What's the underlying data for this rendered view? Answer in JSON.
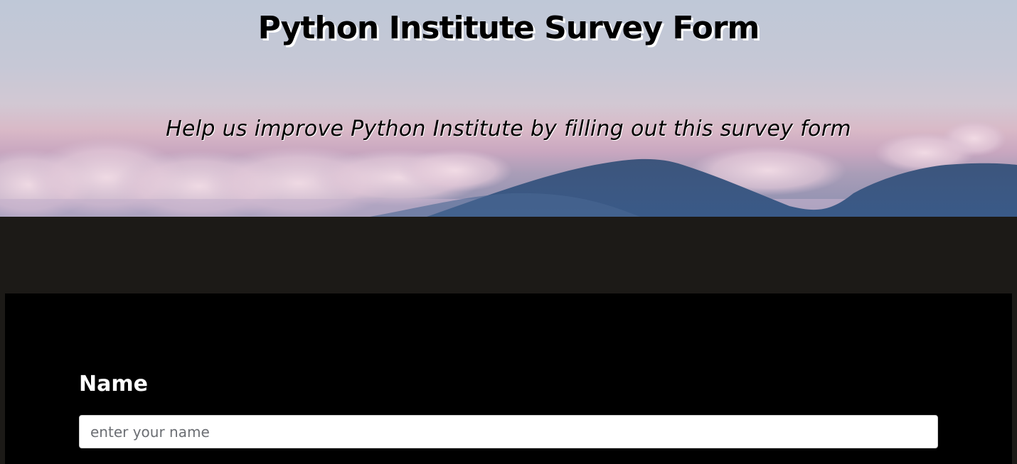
{
  "header": {
    "title": "Python Institute Survey Form",
    "subtitle": "Help us improve Python Institute by filling out this survey form",
    "background_image": "sky-clouds-mountains",
    "colors": {
      "sky_top": "#bfc8d7",
      "sky_pink": "#d9b9c7",
      "mountain": "#3f5b85",
      "page_background": "#1c1a17",
      "panel_background": "#000000"
    }
  },
  "form": {
    "name": {
      "label": "Name",
      "placeholder": "enter your name",
      "value": ""
    }
  }
}
